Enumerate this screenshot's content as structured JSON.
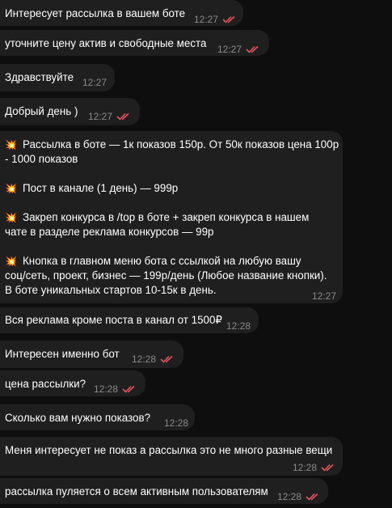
{
  "messages": [
    {
      "text": "Интересует рассылка в вашем боте",
      "time": "12:27",
      "read": true
    },
    {
      "text": "уточните цену актив и свободные места",
      "time": "12:27",
      "read": true
    },
    {
      "text": "Здравствуйте",
      "time": "12:27",
      "read": false
    },
    {
      "text": "Добрый день )",
      "time": "12:27",
      "read": true
    },
    {
      "text": "Вся реклама кроме поста в канал от 1500₽",
      "time": "12:28",
      "read": false
    },
    {
      "text": "Интересен именно бот",
      "time": "12:28",
      "read": true
    },
    {
      "text": "цена рассылки?",
      "time": "12:28",
      "read": true
    },
    {
      "text": "Сколько вам нужно показов?",
      "time": "12:28",
      "read": false
    },
    {
      "text": "Меня интересует не показ а рассылка это не много разные вещи",
      "time": "12:28",
      "read": true
    },
    {
      "text": "рассылка пуляется о всем активным пользователям",
      "time": "12:28",
      "read": true
    }
  ],
  "offer": {
    "time": "12:27",
    "emoji": "💥",
    "line1": "Рассылка в боте — 1к показов 150р. От 50к показов цена 100р",
    "line2": "- 1000 показов",
    "line3": "Пост в канале (1 день) — 999р",
    "line4": "Закреп конкурса в /top в боте + закреп конкурса в нашем",
    "line5": "чате в разделе реклама конкурсов — 99р",
    "line6": "Кнопка в главном меню бота с ссылкой на любую вашу",
    "line7": "соц/сеть, проект, бизнес — 199р/день (Любое название кнопки).",
    "line8": "В боте уникальных стартов 10-15к в день."
  },
  "colors": {
    "bubble": "#1f1f1f",
    "background": "#0e0e0e",
    "check": "#e8545e",
    "time": "#8b8b8b"
  }
}
